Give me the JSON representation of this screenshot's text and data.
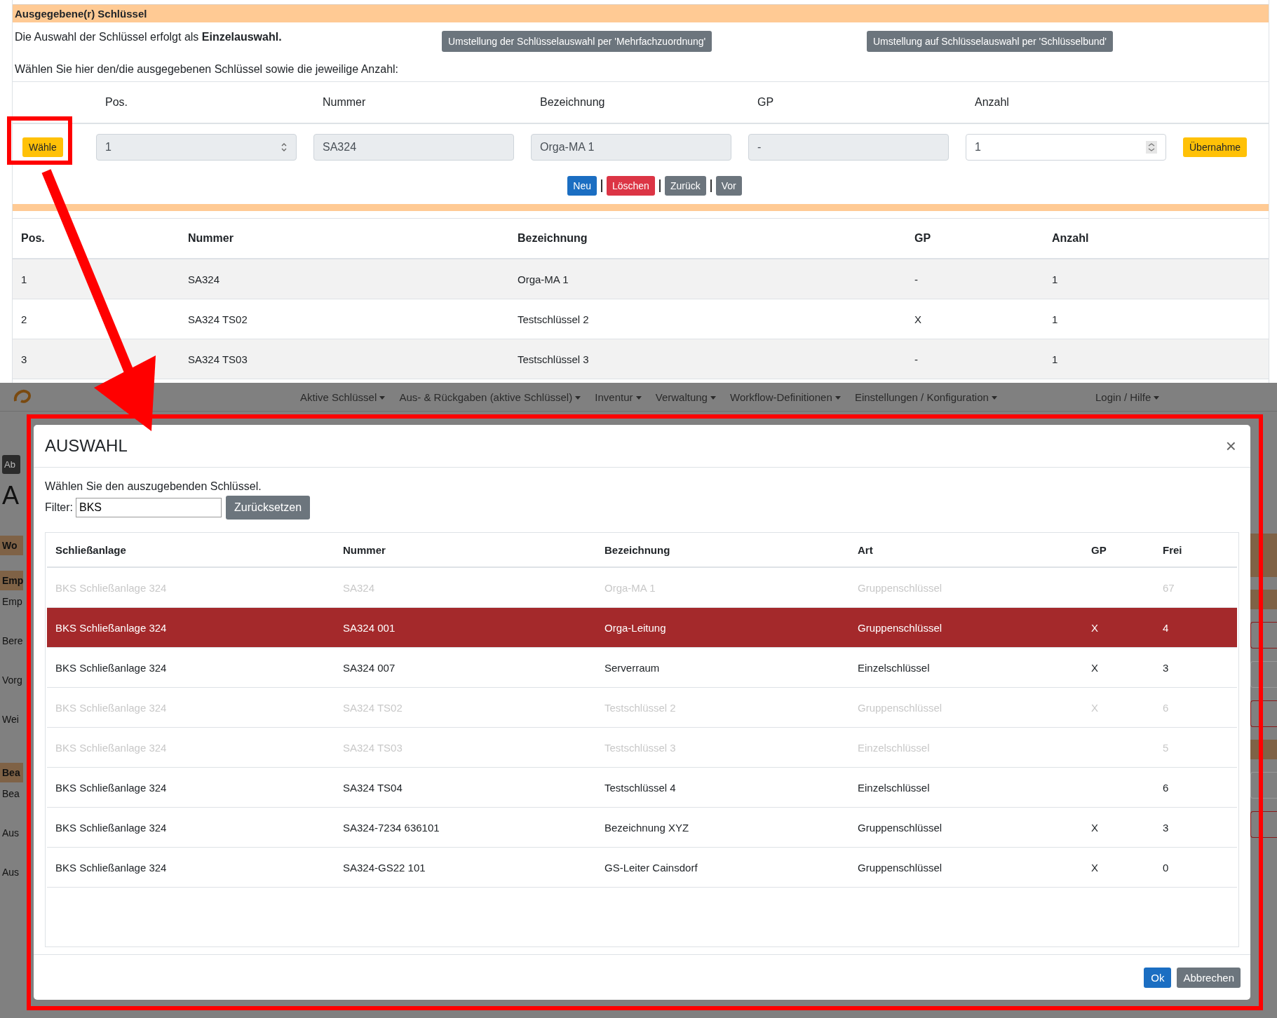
{
  "issued_keys": {
    "title": "Ausgegebene(r) Schlüssel",
    "selection_mode": "Die Auswahl der Schlüssel erfolgt als **Einzelauswahl.**",
    "mode_buttons": [
      "Umstellung der Schlüsselauswahl per 'Mehrfachzuordnung'",
      "Umstellung auf Schlüsselauswahl per 'Schlüsselbund'"
    ],
    "instruction": "Wählen Sie hier den/die ausgegebenen Schlüssel sowie die jeweilige Anzahl:",
    "form_columns": [
      "Pos.",
      "Nummer",
      "Bezeichnung",
      "GP",
      "Anzahl"
    ],
    "choose_button": "Wähle",
    "fields": [
      {
        "kind": "select",
        "value": "1",
        "readonly": true
      },
      {
        "kind": "text",
        "value": "SA324",
        "readonly": true
      },
      {
        "kind": "text",
        "value": "Orga-MA 1",
        "readonly": true
      },
      {
        "kind": "text",
        "value": "-",
        "readonly": true
      },
      {
        "kind": "number",
        "value": "1",
        "readonly": false
      }
    ],
    "apply_button": "Übernahme",
    "nav_buttons": [
      {
        "label": "Neu",
        "kind": "primary"
      },
      {
        "label": "Löschen",
        "kind": "danger"
      },
      {
        "label": "Zurück",
        "kind": "secondary"
      },
      {
        "label": "Vor",
        "kind": "secondary"
      }
    ],
    "table": {
      "columns": [
        "Pos.",
        "Nummer",
        "Bezeichnung",
        "GP",
        "Anzahl"
      ],
      "rows": [
        [
          "1",
          "SA324",
          "Orga-MA 1",
          "-",
          "1"
        ],
        [
          "2",
          "SA324 TS02",
          "Testschlüssel 2",
          "X",
          "1"
        ],
        [
          "3",
          "SA324 TS03",
          "Testschlüssel 3",
          "-",
          "1"
        ]
      ]
    }
  },
  "background_page": {
    "nav_items": [
      "Aktive Schlüssel",
      "Aus- & Rückgaben (aktive Schlüssel)",
      "Inventur",
      "Verwaltung",
      "Workflow-Definitionen",
      "Einstellungen / Konfiguration",
      "Login / Hilfe"
    ],
    "side_fragments": [
      {
        "kind": "button",
        "text": "Ab"
      },
      {
        "kind": "heading",
        "text": "A"
      },
      {
        "kind": "section",
        "text": "Wo"
      },
      {
        "kind": "section",
        "text": "Emp"
      },
      {
        "kind": "label",
        "text": "Emp"
      },
      {
        "kind": "label",
        "text": "Bere"
      },
      {
        "kind": "label",
        "text": "Vorg"
      },
      {
        "kind": "label",
        "text": "Wei"
      },
      {
        "kind": "section",
        "text": "Bea"
      },
      {
        "kind": "label",
        "text": "Bea"
      },
      {
        "kind": "label",
        "text": "Aus"
      },
      {
        "kind": "label",
        "text": "Aus"
      }
    ]
  },
  "modal": {
    "title": "AUSWAHL",
    "close_symbol": "×",
    "instruction": "Wählen Sie den auszugebenden Schlüssel.",
    "filter": {
      "label": "Filter:",
      "value": "BKS"
    },
    "reset_button": "Zurücksetzen",
    "columns": [
      "Schließanlage",
      "Nummer",
      "Bezeichnung",
      "Art",
      "GP",
      "Frei"
    ],
    "rows": [
      {
        "system": "BKS Schließanlage 324",
        "number": "SA324",
        "name": "Orga-MA 1",
        "type": "Gruppenschlüssel",
        "free": "67",
        "selected": false,
        "disabled": true
      },
      {
        "system": "BKS Schließanlage 324",
        "number": "SA324 001",
        "name": "Orga-Leitung",
        "type": "Gruppenschlüssel",
        "gp": "X",
        "free": "4",
        "selected": true,
        "disabled": false
      },
      {
        "system": "BKS Schließanlage 324",
        "number": "SA324 007",
        "name": "Serverraum",
        "type": "Einzelschlüssel",
        "gp": "X",
        "free": "3",
        "selected": false,
        "disabled": false
      },
      {
        "system": "BKS Schließanlage 324",
        "number": "SA324 TS02",
        "name": "Testschlüssel 2",
        "type": "Gruppenschlüssel",
        "gp": "X",
        "free": "6",
        "selected": false,
        "disabled": true
      },
      {
        "system": "BKS Schließanlage 324",
        "number": "SA324 TS03",
        "name": "Testschlüssel 3",
        "type": "Einzelschlüssel",
        "free": "5",
        "selected": false,
        "disabled": true
      },
      {
        "system": "BKS Schließanlage 324",
        "number": "SA324 TS04",
        "name": "Testschlüssel 4",
        "type": "Einzelschlüssel",
        "free": "6",
        "selected": false,
        "disabled": false
      },
      {
        "system": "BKS Schließanlage 324",
        "number": "SA324-7234 636101",
        "name": "Bezeichnung XYZ",
        "type": "Gruppenschlüssel",
        "gp": "X",
        "free": "3",
        "selected": false,
        "disabled": false
      },
      {
        "system": "BKS Schließanlage 324",
        "number": "SA324-GS22 101",
        "name": "GS-Leiter Cainsdorf",
        "type": "Gruppenschlüssel",
        "gp": "X",
        "free": "0",
        "selected": false,
        "disabled": false
      }
    ],
    "ok_button": "Ok",
    "cancel_button": "Abbrechen"
  }
}
